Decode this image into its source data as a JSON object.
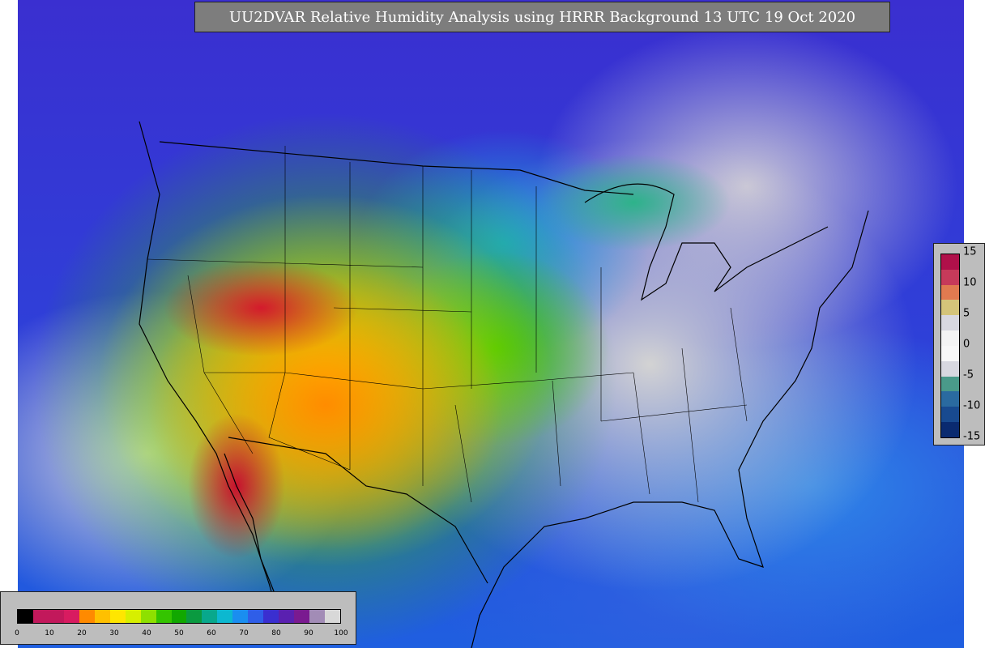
{
  "title": "UU2DVAR Relative Humidity Analysis using HRRR Background 13 UTC 19 Oct 2020",
  "rh_colorbar": {
    "ticks": [
      "0",
      "10",
      "20",
      "30",
      "40",
      "50",
      "60",
      "70",
      "80",
      "90",
      "100"
    ],
    "range": [
      0,
      100
    ],
    "colors": [
      "#000000",
      "#c2185b",
      "#c2185b",
      "#d81b60",
      "#ff8a00",
      "#ffc000",
      "#ffe600",
      "#d7ef00",
      "#8ee000",
      "#34c400",
      "#11a800",
      "#0a9a40",
      "#08a88c",
      "#0cb8d0",
      "#1a8ef0",
      "#2f5ee8",
      "#3a2fd0",
      "#5a20b0",
      "#7a1a90",
      "#a28cb6",
      "#d8d8d8"
    ]
  },
  "increment_colorbar": {
    "ticks": [
      "15",
      "10",
      "5",
      "0",
      "-5",
      "-10",
      "-15"
    ],
    "range": [
      -15,
      15
    ],
    "colors": [
      "#b0104a",
      "#c63a5a",
      "#e07a50",
      "#d4c47a",
      "#d8d8e0",
      "#f4f4f4",
      "#f8f8f8",
      "#d8d8e0",
      "#4a9a8a",
      "#2a6aa0",
      "#184a90",
      "#0a2a70"
    ]
  }
}
